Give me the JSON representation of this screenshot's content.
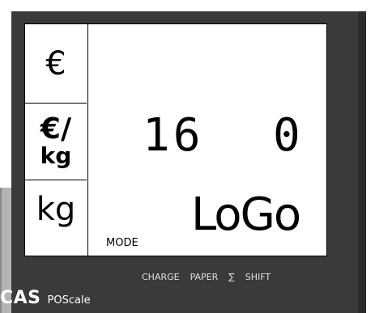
{
  "display": {
    "units": {
      "euro": "€",
      "euro_per": "€/",
      "per_kg": "kg",
      "kg": "kg"
    },
    "readout_left": "16",
    "readout_right": "0",
    "logo": "LoGo",
    "mode_label": "MODE"
  },
  "keys": {
    "charge": "CHARGE",
    "paper": "PAPER",
    "sum": "∑",
    "shift": "SHIFT"
  },
  "brand": {
    "name": "CAS",
    "model": "POScale"
  },
  "colors": {
    "panel": "#3a3a3a",
    "screen": "#ffffff",
    "text": "#000000",
    "bezel": "#b4b4b4"
  }
}
